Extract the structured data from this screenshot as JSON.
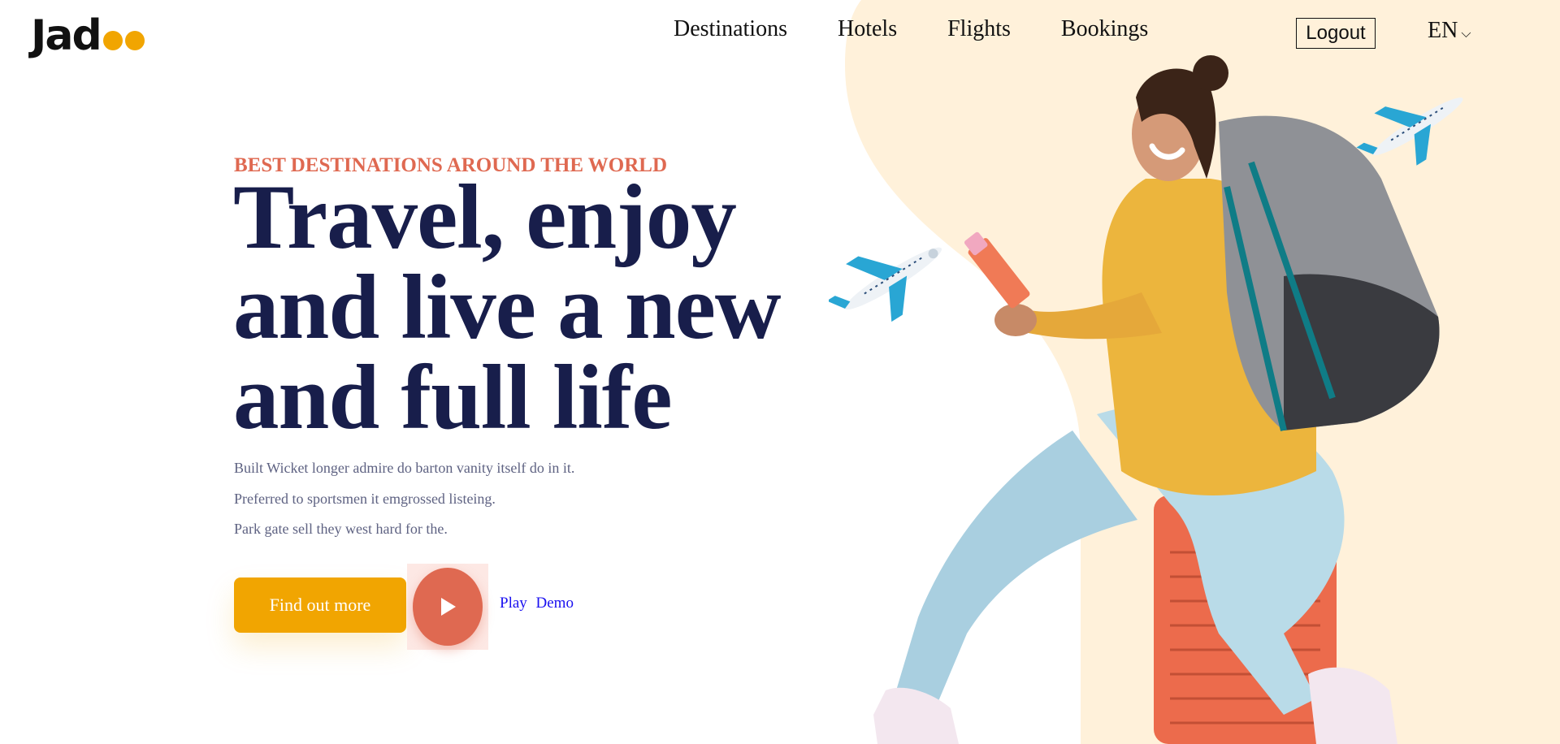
{
  "brand": {
    "logo_text": "Jad",
    "accent": "#f1a501"
  },
  "nav": {
    "items": [
      {
        "label": "Destinations"
      },
      {
        "label": "Hotels"
      },
      {
        "label": "Flights"
      },
      {
        "label": "Bookings"
      }
    ],
    "logout_label": "Logout",
    "language": "EN",
    "language_chevron": "⌵"
  },
  "hero": {
    "kicker": "BEST DESTINATIONS AROUND THE WORLD",
    "headline_lines": [
      "Travel, enjoy",
      "and live a new",
      "and full life"
    ],
    "description_lines": [
      "Built Wicket longer admire do barton vanity itself do in it.",
      "Preferred to sportsmen it emgrossed listeing.",
      "Park gate sell they west hard for the."
    ],
    "cta_label": "Find out more",
    "play_label": "Play Demo",
    "kicker_color": "#df6951",
    "headline_color": "#181e4b",
    "background_blob_color": "#fff1da"
  },
  "icons": {
    "play": "play-icon",
    "airplane": "airplane-icon",
    "chevron": "chevron-down-icon"
  }
}
